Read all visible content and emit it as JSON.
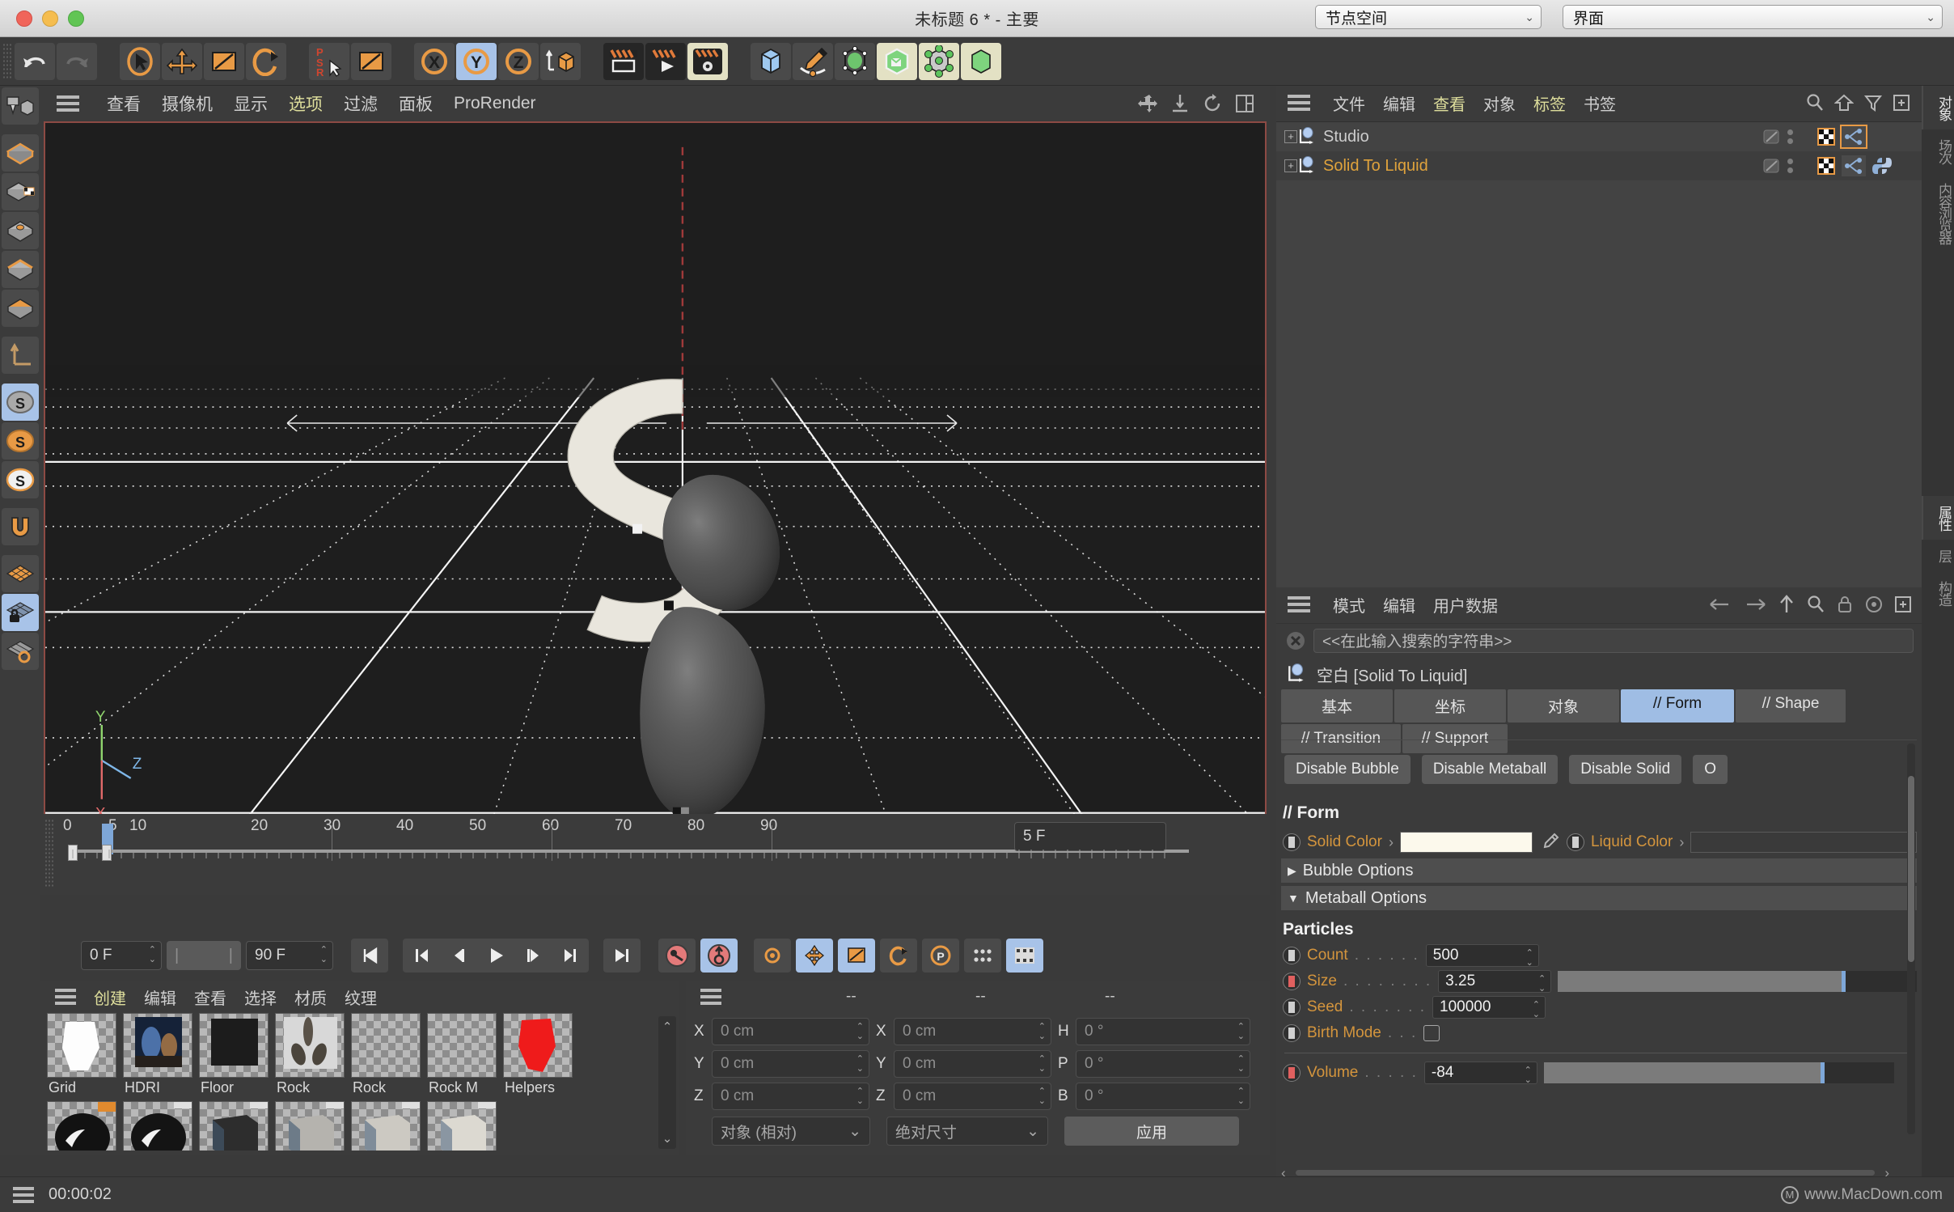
{
  "window": {
    "title": "未标题 6 * - 主要",
    "node_space": "节点空间",
    "layout": "界面"
  },
  "viewport": {
    "menu": [
      "查看",
      "摄像机",
      "显示",
      "选项",
      "过滤",
      "面板",
      "ProRender"
    ],
    "active_menu": "选项",
    "axis_labels": {
      "x": "X",
      "y": "Y",
      "z": "Z"
    }
  },
  "timeline": {
    "ticks": [
      "0",
      "5",
      "10",
      "20",
      "30",
      "40",
      "50",
      "60",
      "70",
      "80",
      "90"
    ],
    "current_frame_box": "5 F",
    "start_field": "0 F",
    "end_field": "90 F",
    "current_frame": 5,
    "range_start": 0,
    "range_end": 90
  },
  "material_manager": {
    "menu": [
      "创建",
      "编辑",
      "查看",
      "选择",
      "材质",
      "纹理"
    ],
    "active_menu": "创建",
    "materials_row1": [
      "Grid",
      "HDRI",
      "Floor",
      "Rock",
      "Rock",
      "Rock M",
      "Helpers"
    ],
    "materials_row2_count": 6
  },
  "coordinates": {
    "headers": [
      "--",
      "--",
      "--"
    ],
    "rows": [
      {
        "l1": "X",
        "v1": "0 cm",
        "l2": "X",
        "v2": "0 cm",
        "l3": "H",
        "v3": "0 °"
      },
      {
        "l1": "Y",
        "v1": "0 cm",
        "l2": "Y",
        "v2": "0 cm",
        "l3": "P",
        "v3": "0 °"
      },
      {
        "l1": "Z",
        "v1": "0 cm",
        "l2": "Z",
        "v2": "0 cm",
        "l3": "B",
        "v3": "0 °"
      }
    ],
    "mode_select": "对象 (相对)",
    "size_select": "绝对尺寸",
    "apply_button": "应用"
  },
  "object_manager": {
    "menu": [
      "文件",
      "编辑",
      "查看",
      "对象",
      "标签",
      "书签"
    ],
    "active_menu": [
      "查看",
      "标签"
    ],
    "rows": [
      {
        "name": "Studio",
        "highlighted": false
      },
      {
        "name": "Solid To Liquid",
        "highlighted": true
      }
    ]
  },
  "attributes": {
    "menu": [
      "模式",
      "编辑",
      "用户数据"
    ],
    "search_placeholder": "<<在此输入搜索的字符串>>",
    "object_title": "空白 [Solid To Liquid]",
    "tabs_row1": [
      "基本",
      "坐标",
      "对象",
      "// Form",
      "// Shape"
    ],
    "tabs_row2": [
      "// Transition",
      "// Support"
    ],
    "selected_tab": "// Form",
    "disable_buttons": [
      "Disable Bubble",
      "Disable Metaball",
      "Disable Solid",
      "O"
    ],
    "form_heading": "// Form",
    "solid_color_label": "Solid Color",
    "solid_color_value": "#FCF9EC",
    "liquid_color_label": "Liquid Color",
    "liquid_color_value": "#3a3a3a",
    "fold_bubble": "Bubble Options",
    "fold_metaball": "Metaball Options",
    "particles_heading": "Particles",
    "properties": [
      {
        "label": "Count",
        "dots": ". . . . . .",
        "value": "500",
        "slider": false,
        "animated": false
      },
      {
        "label": "Size",
        "dots": ". . . . . . . .",
        "value": "3.25",
        "slider": true,
        "fill": 0.79,
        "animated": true
      },
      {
        "label": "Seed",
        "dots": ". . . . . . .",
        "value": "100000",
        "slider": false,
        "animated": false
      },
      {
        "label": "Birth Mode",
        "dots": ". . .",
        "value": "",
        "checkbox": true,
        "animated": false
      },
      {
        "label": "Volume",
        "dots": ". . . . .",
        "value": "-84",
        "slider": true,
        "fill": 0.79,
        "animated": true
      }
    ]
  },
  "vtabs_top": [
    "对象",
    "场次",
    "内容浏览器"
  ],
  "vtabs_bottom": [
    "属性",
    "层",
    "构造"
  ],
  "statusbar": {
    "time": "00:00:02",
    "watermark": "www.MacDown.com"
  },
  "colors": {
    "accent_orange": "#d4953d",
    "selection_blue": "#9fbde4",
    "menu_active": "#dede9c",
    "viewport_border": "#8d4a44"
  }
}
